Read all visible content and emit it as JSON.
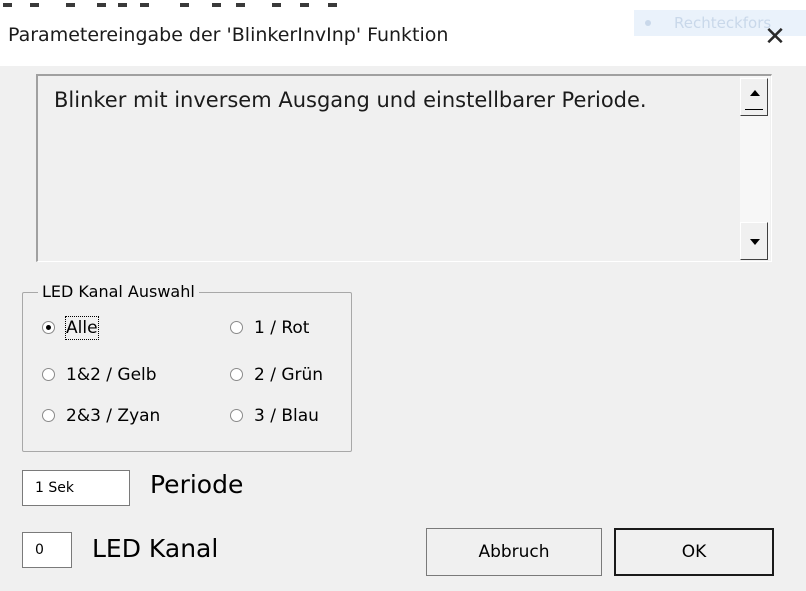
{
  "dialog": {
    "title": "Parametereingabe der 'BlinkerInvInp' Funktion",
    "close_glyph": "✕"
  },
  "background_window": {
    "text": "Rechteckfors"
  },
  "description": {
    "text": "Blinker mit inversem Ausgang und einstellbarer Periode."
  },
  "led_group": {
    "title": "LED Kanal Auswahl",
    "options": [
      {
        "label": "Alle",
        "checked": true
      },
      {
        "label": "1 / Rot",
        "checked": false
      },
      {
        "label": "1&2 / Gelb",
        "checked": false
      },
      {
        "label": "2 / Grün",
        "checked": false
      },
      {
        "label": "2&3 / Zyan",
        "checked": false
      },
      {
        "label": "3 / Blau",
        "checked": false
      }
    ]
  },
  "periode": {
    "value": "1 Sek",
    "label": "Periode"
  },
  "led_kanal": {
    "value": "0",
    "label": "LED Kanal"
  },
  "buttons": {
    "cancel": "Abbruch",
    "ok": "OK"
  },
  "colors": {
    "dialog_bg": "#f0f0f0",
    "titlebar_bg": "#ffffff",
    "text": "#000000"
  }
}
